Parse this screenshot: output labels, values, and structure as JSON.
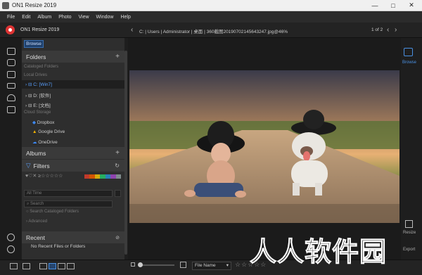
{
  "window": {
    "title": "ON1 Resize 2019",
    "minimize": "—",
    "maximize": "□",
    "close": "✕"
  },
  "menu": [
    "File",
    "Edit",
    "Album",
    "Photo",
    "View",
    "Window",
    "Help"
  ],
  "toolbar": {
    "app_name": "ON1 Resize 2019",
    "path": "C:  |  Users  |  Administrator  |  桌面  |  360截图20190702145643247.jpg@46%",
    "pager": "1 of 2"
  },
  "browse_tab": "Browse",
  "folders": {
    "title": "Folders",
    "cataloged": "Cataloged Folders",
    "local_drives": "Local Drives",
    "drives": [
      "C: [Win7]",
      "D: [软件]",
      "E: [文档]"
    ],
    "cloud_storage": "Cloud Storage",
    "clouds": [
      "Dropbox",
      "Google Drive",
      "OneDrive"
    ]
  },
  "albums": {
    "title": "Albums"
  },
  "filters": {
    "title": "Filters",
    "rating_symbols": "♥♡✕  ≥☆☆☆☆☆",
    "time": "All Time",
    "search_placeholder": "Search",
    "search_cataloged": "Search Cataloged Folders",
    "advanced": "Advanced",
    "label_colors": [
      "#c0392b",
      "#d35400",
      "#d4ac0d",
      "#27ae60",
      "#2980b9",
      "#8e44ad",
      "#7f8c8d"
    ]
  },
  "recent": {
    "title": "Recent",
    "empty": "No Recent Files or Folders"
  },
  "right_panel": {
    "browse": "Browse",
    "resize": "Resize",
    "export": "Export"
  },
  "bottom": {
    "sort": "File Name",
    "stars": "☆☆☆☆☆"
  },
  "watermark": "人人软件园",
  "colors": {
    "accent": "#4a90e2",
    "panel": "#2e2e2e",
    "bg": "#1b1b1b"
  }
}
